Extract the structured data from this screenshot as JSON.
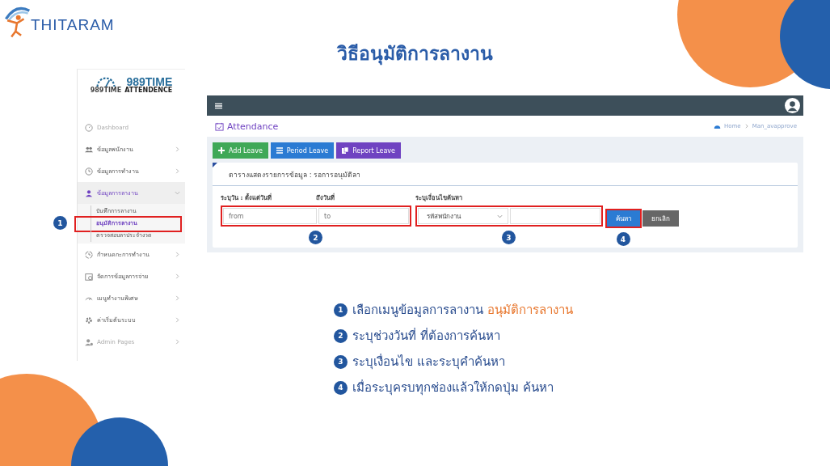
{
  "logo": {
    "text": "THITARAM"
  },
  "title": "วิธีอนุมัติการลางาน",
  "sidebar": {
    "brand_small": "989TIME",
    "brand": "989TIME",
    "brand_sub": "ATTENDENCE",
    "items": [
      {
        "label": "Dashboard",
        "muted": true
      },
      {
        "label": "ข้อมูลพนักงาน",
        "muted": false,
        "expanded": false
      },
      {
        "label": "ข้อมูลการทำงาน",
        "muted": false,
        "expanded": false
      },
      {
        "label": "ข้อมูลการลางาน",
        "muted": false,
        "expanded": true,
        "children": [
          {
            "label": "บันทึกการลางาน",
            "selected": false
          },
          {
            "label": "อนุมัติการลางาน",
            "selected": true,
            "highlight": "1"
          },
          {
            "label": "ตรวจสอบลาประจำงวด",
            "selected": false
          }
        ]
      },
      {
        "label": "กำหนดกะการทำงาน",
        "muted": false,
        "expanded": false
      },
      {
        "label": "จัดการข้อมูลการจ่าย",
        "muted": false,
        "expanded": false
      },
      {
        "label": "เมนูทำงานพิเศษ",
        "muted": false,
        "expanded": false
      },
      {
        "label": "ค่าเริ่มต้นระบบ",
        "muted": false,
        "expanded": false
      },
      {
        "label": "Admin Pages",
        "muted": true,
        "expanded": false
      }
    ]
  },
  "app": {
    "page_title": "Attendance",
    "breadcrumb": [
      "Home",
      "Man_avapprove"
    ],
    "actions": [
      {
        "label": "Add Leave",
        "color": "#3fa857"
      },
      {
        "label": "Period Leave",
        "color": "#2b7bd3"
      },
      {
        "label": "Report Leave",
        "color": "#6f42c1"
      }
    ],
    "card_title": "ตารางแสดงรายการข้อมูล : รอการอนุมัติลา",
    "date_label": "ระบุวัน : ตั้งแต่วันที่",
    "to_label": "ถึงวันที่",
    "filter_label": "ระบุเงื่อนไขค้นหา",
    "from_field": {
      "placeholder": "from"
    },
    "to_field": {
      "placeholder": "to"
    },
    "filter_select": {
      "value": "รหัสพนักงาน"
    },
    "buttons": [
      {
        "label": "ค้นหา",
        "kind": "primary",
        "highlight": "4"
      },
      {
        "label": "ยกเลิก",
        "kind": "secondary"
      }
    ],
    "step_dates": "2",
    "step_filter": "3"
  },
  "steps": [
    {
      "number": "1",
      "text": "เลือกเมนูข้อมูลการลางาน",
      "highlight": "อนุมัติการลางาน"
    },
    {
      "number": "2",
      "text": "ระบุช่วงวันที่ ที่ต้องการค้นหา"
    },
    {
      "number": "3",
      "text": "ระบุเงื่อนไข และระบุคำค้นหา"
    },
    {
      "number": "4",
      "text": "เมื่อระบุครบทุกช่องแล้วให้กดปุ่ม ค้นหา"
    }
  ]
}
